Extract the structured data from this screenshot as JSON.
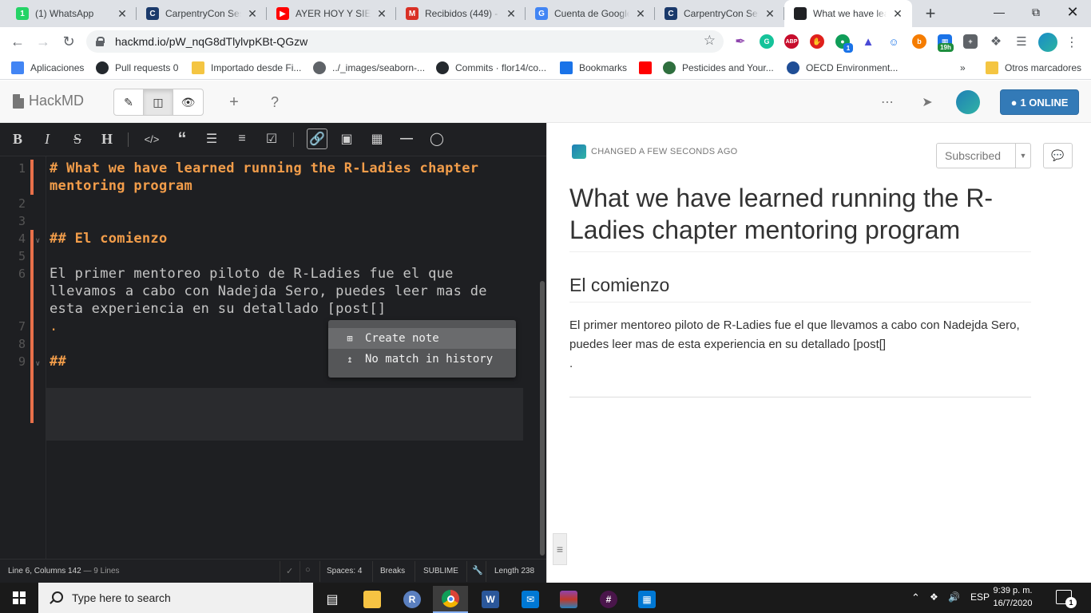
{
  "browser": {
    "tabs": [
      {
        "label": "(1) WhatsApp",
        "icon": "whatsapp-icon",
        "color": "#25d366",
        "glyph": "1"
      },
      {
        "label": "CarpentryCon Sessions",
        "icon": "carpentries-icon",
        "color": "#1b3a6b",
        "glyph": "C"
      },
      {
        "label": "AYER HOY Y SIEMPRE",
        "icon": "youtube-icon",
        "color": "#ff0000",
        "glyph": "▶"
      },
      {
        "label": "Recibidos (449) - flor",
        "icon": "gmail-icon",
        "color": "#d93025",
        "glyph": "M"
      },
      {
        "label": "Cuenta de Google",
        "icon": "google-icon",
        "color": "#4285f4",
        "glyph": "G"
      },
      {
        "label": "CarpentryCon Sessions",
        "icon": "carpentries-icon",
        "color": "#1b3a6b",
        "glyph": "C"
      },
      {
        "label": "What we have learned",
        "icon": "document-icon",
        "color": "#202124",
        "glyph": ""
      }
    ],
    "url": "hackmd.io/pW_nqG8dTlylvpKBt-QGzw",
    "extension_badges": {
      "extension_6_badge": "1",
      "extension_12_badge": "19h"
    },
    "bookmarks": [
      {
        "label": "Aplicaciones",
        "icon": "apps-grid-icon",
        "color": "#4285f4"
      },
      {
        "label": "Pull requests 0",
        "icon": "github-icon",
        "color": "#24292e"
      },
      {
        "label": "Importado desde Fi...",
        "icon": "folder-icon",
        "color": "#f4c542"
      },
      {
        "label": "../_images/seaborn-...",
        "icon": "globe-icon",
        "color": "#5f6368"
      },
      {
        "label": "Commits · flor14/co...",
        "icon": "github-icon",
        "color": "#24292e"
      },
      {
        "label": "Bookmarks",
        "icon": "star-icon",
        "color": "#1a73e8"
      },
      {
        "label": "",
        "icon": "youtube-icon",
        "color": "#ff0000"
      },
      {
        "label": "Pesticides and Your...",
        "icon": "globe-icon",
        "color": "#2f6f3e"
      },
      {
        "label": "OECD Environment...",
        "icon": "oecd-icon",
        "color": "#1f4e96"
      },
      {
        "label": "»",
        "icon": "more-bookmarks-icon",
        "color": "#5f6368"
      },
      {
        "label": "Otros marcadores",
        "icon": "folder-icon",
        "color": "#f4c542"
      }
    ]
  },
  "hackmd": {
    "brand": "HackMD",
    "online_label": "1 ONLINE",
    "toolbar_tooltips": [
      "Bold",
      "Italic",
      "Strikethrough",
      "Heading",
      "Code",
      "Quote",
      "Unordered list",
      "Ordered list",
      "Check list",
      "Link",
      "Image",
      "Table",
      "Line",
      "Comment"
    ]
  },
  "editor": {
    "lines": [
      {
        "num": "1",
        "text": "# What we have learned running the R-Ladies chapter",
        "kind": "heading"
      },
      {
        "num": "",
        "text": "mentoring program",
        "kind": "heading"
      },
      {
        "num": "2",
        "text": "",
        "kind": "text"
      },
      {
        "num": "3",
        "text": "",
        "kind": "text"
      },
      {
        "num": "4",
        "text": "## El comienzo",
        "kind": "heading"
      },
      {
        "num": "5",
        "text": "",
        "kind": "text"
      },
      {
        "num": "6",
        "text": "El primer mentoreo piloto de R-Ladies fue el que",
        "kind": "text"
      },
      {
        "num": "",
        "text": "llevamos a cabo con Nadejda Sero, puedes leer mas de",
        "kind": "text"
      },
      {
        "num": "",
        "text": "esta experiencia en su detallado [post[]",
        "kind": "text"
      },
      {
        "num": "7",
        "text": ".",
        "kind": "dot"
      },
      {
        "num": "8",
        "text": "",
        "kind": "text"
      },
      {
        "num": "9",
        "text": "##",
        "kind": "heading"
      }
    ],
    "autocomplete": [
      {
        "label": "Create note",
        "icon": "plus-square-icon"
      },
      {
        "label": "No match in history",
        "icon": "arrow-up-icon"
      }
    ],
    "status": {
      "position": "Line 6, Columns 142",
      "line_count": "— 9 Lines",
      "spaces": "Spaces: 4",
      "breaks": "Breaks",
      "keymap": "SUBLIME",
      "length": "Length 238"
    }
  },
  "preview": {
    "changed": "CHANGED A FEW SECONDS AGO",
    "subscribed": "Subscribed",
    "h1": "What we have learned running the R-Ladies chapter mentoring program",
    "h2": "El comienzo",
    "body": "El primer mentoreo piloto de R-Ladies fue el que llevamos a cabo con Nadejda Sero, puedes leer mas de esta experiencia en su detallado [post[]",
    "body_tail": "."
  },
  "taskbar": {
    "search_placeholder": "Type here to search",
    "language": "ESP",
    "time": "9:39 p. m.",
    "date": "16/7/2020",
    "notification_count": "1"
  }
}
